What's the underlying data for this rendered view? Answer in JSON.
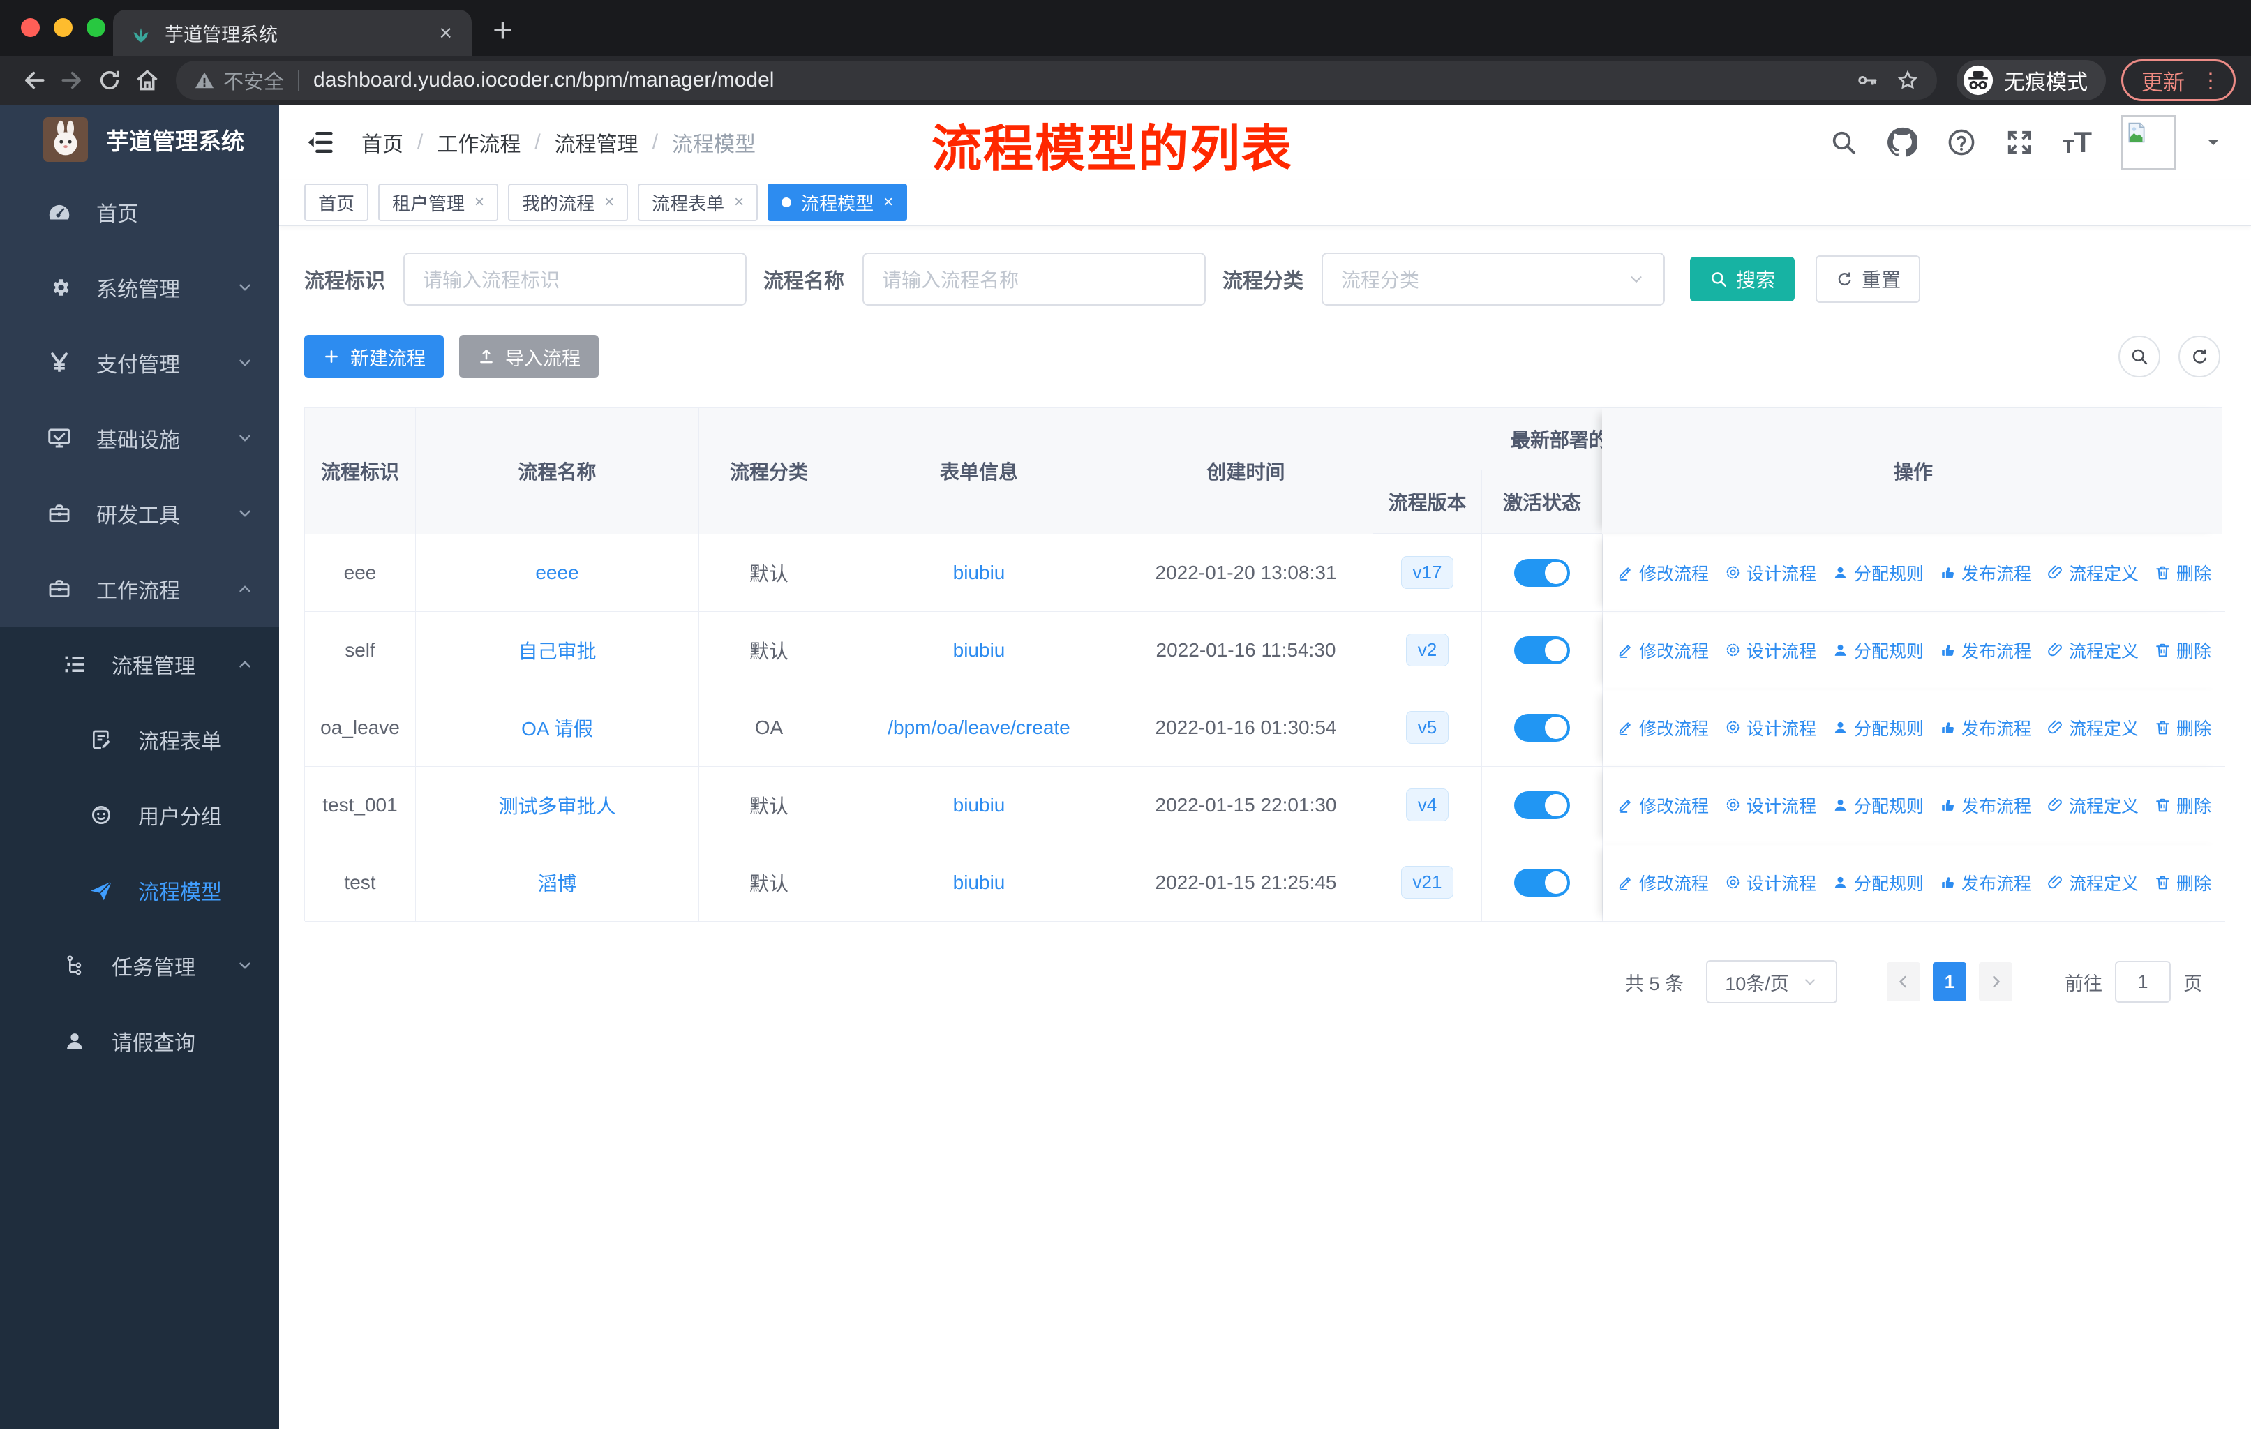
{
  "browser": {
    "tab_title": "芋道管理系统",
    "new_tab_label": "+",
    "close_label": "×",
    "security_label": "不安全",
    "url": "dashboard.yudao.iocoder.cn/bpm/manager/model",
    "incognito_label": "无痕模式",
    "update_label": "更新"
  },
  "sidebar": {
    "title": "芋道管理系统",
    "items": [
      {
        "id": "home",
        "label": "首页",
        "icon": "gauge-icon",
        "level": 1,
        "sub": false,
        "chevron": null,
        "active": false
      },
      {
        "id": "system-management",
        "label": "系统管理",
        "icon": "gear-icon",
        "level": 1,
        "sub": false,
        "chevron": "down",
        "active": false
      },
      {
        "id": "payment-management",
        "label": "支付管理",
        "icon": "yen-icon",
        "level": 1,
        "sub": false,
        "chevron": "down",
        "active": false
      },
      {
        "id": "infrastructure",
        "label": "基础设施",
        "icon": "monitor-icon",
        "level": 1,
        "sub": false,
        "chevron": "down",
        "active": false
      },
      {
        "id": "dev-tools",
        "label": "研发工具",
        "icon": "toolbox-icon",
        "level": 1,
        "sub": false,
        "chevron": "down",
        "active": false
      },
      {
        "id": "workflow",
        "label": "工作流程",
        "icon": "briefcase-icon",
        "level": 1,
        "sub": false,
        "chevron": "up",
        "active": false
      },
      {
        "id": "process-management",
        "label": "流程管理",
        "icon": "tree-list-icon",
        "level": 2,
        "sub": true,
        "chevron": "up",
        "active": false
      },
      {
        "id": "process-form",
        "label": "流程表单",
        "icon": "form-doc-icon",
        "level": 3,
        "sub": true,
        "chevron": null,
        "active": false
      },
      {
        "id": "user-group",
        "label": "用户分组",
        "icon": "user-group-icon",
        "level": 3,
        "sub": true,
        "chevron": null,
        "active": false
      },
      {
        "id": "process-model",
        "label": "流程模型",
        "icon": "paper-plane-icon",
        "level": 3,
        "sub": true,
        "chevron": null,
        "active": true
      },
      {
        "id": "task-management",
        "label": "任务管理",
        "icon": "org-tree-icon",
        "level": 2,
        "sub": true,
        "chevron": "down",
        "active": false
      },
      {
        "id": "leave-query",
        "label": "请假查询",
        "icon": "user-icon",
        "level": 2,
        "sub": true,
        "chevron": null,
        "active": false
      }
    ]
  },
  "header": {
    "breadcrumb": [
      "首页",
      "工作流程",
      "流程管理",
      "流程模型"
    ],
    "annotation": "流程模型的列表"
  },
  "tags": [
    {
      "id": "home",
      "label": "首页",
      "closable": false,
      "active": false
    },
    {
      "id": "tenant-management",
      "label": "租户管理",
      "closable": true,
      "active": false
    },
    {
      "id": "my-process",
      "label": "我的流程",
      "closable": true,
      "active": false
    },
    {
      "id": "process-form",
      "label": "流程表单",
      "closable": true,
      "active": false
    },
    {
      "id": "process-model",
      "label": "流程模型",
      "closable": true,
      "active": true
    }
  ],
  "filters": {
    "key_label": "流程标识",
    "key_placeholder": "请输入流程标识",
    "name_label": "流程名称",
    "name_placeholder": "请输入流程名称",
    "category_label": "流程分类",
    "category_placeholder": "流程分类",
    "search_label": "搜索",
    "reset_label": "重置"
  },
  "toolbar": {
    "create_label": "新建流程",
    "import_label": "导入流程"
  },
  "table": {
    "columns": {
      "key": "流程标识",
      "name": "流程名称",
      "category": "流程分类",
      "form": "表单信息",
      "created": "创建时间",
      "group": "最新部署的",
      "version": "流程版本",
      "active": "激活状态",
      "op": "操作"
    },
    "actions": [
      {
        "id": "modify",
        "label": "修改流程",
        "icon": "edit-icon"
      },
      {
        "id": "design",
        "label": "设计流程",
        "icon": "design-gear-icon"
      },
      {
        "id": "assign-rules",
        "label": "分配规则",
        "icon": "assign-user-icon"
      },
      {
        "id": "publish",
        "label": "发布流程",
        "icon": "publish-thumb-icon"
      },
      {
        "id": "definition",
        "label": "流程定义",
        "icon": "paperclip-icon"
      },
      {
        "id": "delete",
        "label": "删除",
        "icon": "trash-icon"
      }
    ],
    "rows": [
      {
        "key": "eee",
        "name": "eeee",
        "category": "默认",
        "form": "biubiu",
        "created": "2022-01-20 13:08:31",
        "version": "v17",
        "active": true
      },
      {
        "key": "self",
        "name": "自己审批",
        "category": "默认",
        "form": "biubiu",
        "created": "2022-01-16 11:54:30",
        "version": "v2",
        "active": true
      },
      {
        "key": "oa_leave",
        "name": "OA 请假",
        "category": "OA",
        "form": "/bpm/oa/leave/create",
        "created": "2022-01-16 01:30:54",
        "version": "v5",
        "active": true
      },
      {
        "key": "test_001",
        "name": "测试多审批人",
        "category": "默认",
        "form": "biubiu",
        "created": "2022-01-15 22:01:30",
        "version": "v4",
        "active": true
      },
      {
        "key": "test",
        "name": "滔博",
        "category": "默认",
        "form": "biubiu",
        "created": "2022-01-15 21:25:45",
        "version": "v21",
        "active": true
      }
    ]
  },
  "pagination": {
    "total": "共 5 条",
    "page_size": "10条/页",
    "current_page": "1",
    "goto_label": "前往",
    "goto_value": "1",
    "page_unit": "页"
  },
  "colors": {
    "primary_blue": "#2d8cf0",
    "link_blue": "#2d8cf0",
    "search_teal": "#17b3a3",
    "annotation_red": "#ff2800",
    "toggle_on": "#2196f3",
    "sidebar_bg": "#2e3c50",
    "submenu_bg": "#1f2d3d",
    "active_menu_text": "#409EFF"
  }
}
